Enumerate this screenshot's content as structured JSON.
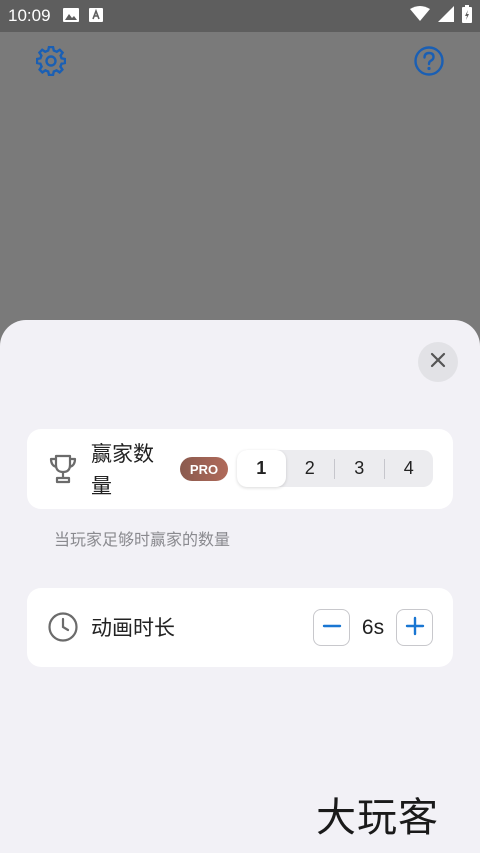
{
  "status_bar": {
    "time": "10:09",
    "left_icons": [
      "image-icon",
      "a-box-icon"
    ],
    "right_icons": [
      "wifi-icon",
      "signal-icon",
      "battery-icon"
    ]
  },
  "header": {
    "settings_icon": "gear-icon",
    "help_icon": "help-circle-icon",
    "accent_color": "#1a5fb4"
  },
  "sheet": {
    "close_icon": "close-icon",
    "winners": {
      "icon": "trophy-icon",
      "label": "赢家数量",
      "badge": "PRO",
      "options": [
        "1",
        "2",
        "3",
        "4"
      ],
      "selected": "1",
      "hint": "当玩家足够时赢家的数量"
    },
    "animation": {
      "icon": "clock-icon",
      "label": "动画时长",
      "value": "6s",
      "minus_icon": "minus-icon",
      "plus_icon": "plus-icon"
    }
  },
  "watermark": "大玩客"
}
